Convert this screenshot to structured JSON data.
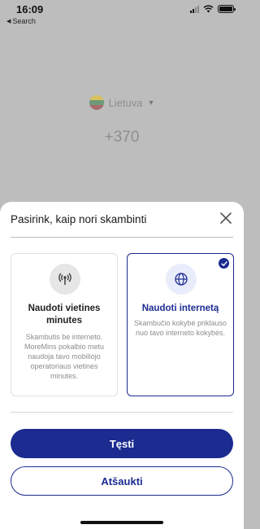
{
  "status_bar": {
    "time": "16:09",
    "back_label": "Search",
    "icons": [
      "cellular-signal-icon",
      "wifi-icon",
      "battery-icon"
    ]
  },
  "background": {
    "country_name": "Lietuva",
    "country_flag_colors": [
      "#f5c400",
      "#1a8a3c",
      "#c8252c"
    ],
    "dial_prefix": "+370"
  },
  "sheet": {
    "title": "Pasirink, kaip nori skambinti",
    "close_icon": "close-icon",
    "options": [
      {
        "icon": "antenna-icon",
        "title": "Naudoti vietines minutes",
        "description": "Skambutis be interneto. MoreMins pokalbio metu naudoja tavo mobiliojo operatoriaus vietines minutes.",
        "selected": false
      },
      {
        "icon": "globe-icon",
        "title": "Naudoti internetą",
        "description": "Skambučio kokybė priklauso nuo tavo interneto kokybės.",
        "selected": true
      }
    ],
    "continue_label": "Tęsti",
    "cancel_label": "Atšaukti"
  },
  "colors": {
    "accent": "#1b2b8f",
    "overlay": "#bdbdbd",
    "muted_text": "#8c8c8c"
  }
}
